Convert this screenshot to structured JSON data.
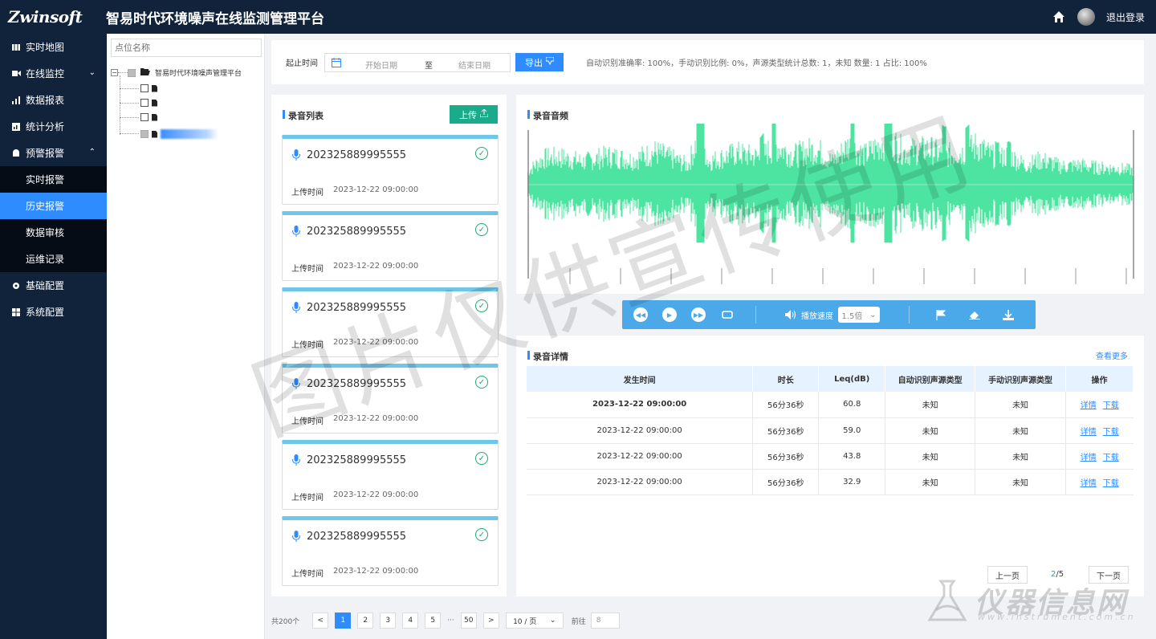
{
  "header": {
    "logo_text": "Zwinsoft",
    "title": "智易时代环境噪声在线监测管理平台",
    "logout_label": "退出登录"
  },
  "sidebar": {
    "items": [
      {
        "label": "实时地图",
        "icon": "map-icon"
      },
      {
        "label": "在线监控",
        "icon": "video-icon"
      },
      {
        "label": "数据报表",
        "icon": "bar-chart-icon"
      },
      {
        "label": "统计分析",
        "icon": "analysis-icon"
      },
      {
        "label": "预警报警",
        "icon": "alarm-icon"
      }
    ],
    "sub_items": [
      {
        "label": "实时报警"
      },
      {
        "label": "历史报警"
      },
      {
        "label": "数据审核"
      },
      {
        "label": "运维记录"
      }
    ],
    "bottom_items": [
      {
        "label": "基础配置",
        "icon": "gear-icon"
      },
      {
        "label": "系统配置",
        "icon": "windows-icon"
      }
    ]
  },
  "tree": {
    "search_placeholder": "点位名称",
    "root_label": "智易时代环境噪声管理平台"
  },
  "filter": {
    "label": "起止时间",
    "start_placeholder": "开始日期",
    "separator": "至",
    "end_placeholder": "结束日期",
    "export_label": "导出",
    "stats": "自动识别准确率: 100%，手动识别比例: 0%，声源类型统计总数: 1，未知 数量: 1 占比: 100%"
  },
  "recordings": {
    "title": "录音列表",
    "upload_label": "上传",
    "upload_time_label": "上传时间",
    "items": [
      {
        "id": "202325889995555",
        "time": "2023-12-22 09:00:00"
      },
      {
        "id": "202325889995555",
        "time": "2023-12-22 09:00:00"
      },
      {
        "id": "202325889995555",
        "time": "2023-12-22 09:00:00"
      },
      {
        "id": "202325889995555",
        "time": "2023-12-22 09:00:00"
      },
      {
        "id": "202325889995555",
        "time": "2023-12-22 09:00:00"
      },
      {
        "id": "202325889995555",
        "time": "2023-12-22 09:00:00"
      }
    ]
  },
  "waveform": {
    "title": "录音音频",
    "color": "#4de3a0"
  },
  "player": {
    "speed_label": "播放速度",
    "speed_value": "1.5倍"
  },
  "details": {
    "title": "录音详情",
    "more_label": "查看更多",
    "columns": [
      "发生时间",
      "时长",
      "Leq(dB)",
      "自动识别声源类型",
      "手动识别声源类型",
      "操作"
    ],
    "rows": [
      {
        "time": "2023-12-22  09:00:00",
        "duration": "56分36秒",
        "leq": "60.8",
        "auto": "未知",
        "manual": "未知",
        "detail": "详情",
        "download": "下载"
      },
      {
        "time": "2023-12-22  09:00:00",
        "duration": "56分36秒",
        "leq": "59.0",
        "auto": "未知",
        "manual": "未知",
        "detail": "详情",
        "download": "下载"
      },
      {
        "time": "2023-12-22  09:00:00",
        "duration": "56分36秒",
        "leq": "43.8",
        "auto": "未知",
        "manual": "未知",
        "detail": "详情",
        "download": "下载"
      },
      {
        "time": "2023-12-22  09:00:00",
        "duration": "56分36秒",
        "leq": "32.9",
        "auto": "未知",
        "manual": "未知",
        "detail": "详情",
        "download": "下载"
      }
    ],
    "prev_label": "上一页",
    "next_label": "下一页",
    "page_current": "2",
    "page_total": "/5"
  },
  "pagination": {
    "total": "共200个",
    "prev": "<",
    "next": ">",
    "pages": [
      "1",
      "2",
      "3",
      "4",
      "5"
    ],
    "dots": "···",
    "last": "50",
    "page_size": "10 / 页",
    "goto_label": "前往",
    "goto_value": "8"
  },
  "watermark": {
    "text": "图片仅供宣传使用",
    "brand_cn": "仪器信息网",
    "brand_en": "www.instrument.com.cn"
  },
  "colors": {
    "header_bg": "#11233b",
    "accent": "#2f8cff",
    "upload_green": "#1aab8a",
    "player_blue": "#4ba9ea"
  }
}
